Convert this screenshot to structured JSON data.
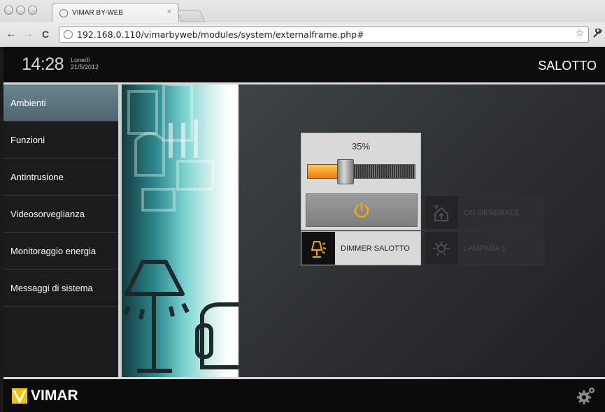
{
  "browser": {
    "tab_title": "VIMAR BY-WEB",
    "tab_close": "×",
    "url": "192.168.0.110/vimarbyweb/modules/system/externalframe.php#",
    "back": "←",
    "forward": "→",
    "reload": "C",
    "star": "☆",
    "wrench": "🔧"
  },
  "header": {
    "time": "14:28",
    "day": "Lunedì",
    "date": "21/5/2012",
    "room": "SALOTTO"
  },
  "sidebar": {
    "items": [
      {
        "label": "Ambienti",
        "active": true
      },
      {
        "label": "Funzioni"
      },
      {
        "label": "Antintrusione"
      },
      {
        "label": "Videosorveglianza"
      },
      {
        "label": "Monitoraggio energia"
      },
      {
        "label": "Messaggi di sistema"
      }
    ]
  },
  "dimmer": {
    "level_label": "35%",
    "level": 0.35,
    "fill_color": "#f0a020",
    "power_color": "#f6a800"
  },
  "tiles": {
    "dimmer_salotto": "DIMMER SALOTTO",
    "on_generale": "ON GENERALE",
    "lampada_1": "LAMPADA 1"
  },
  "footer": {
    "brand": "VIMAR",
    "brand_color": "#f2c200"
  }
}
